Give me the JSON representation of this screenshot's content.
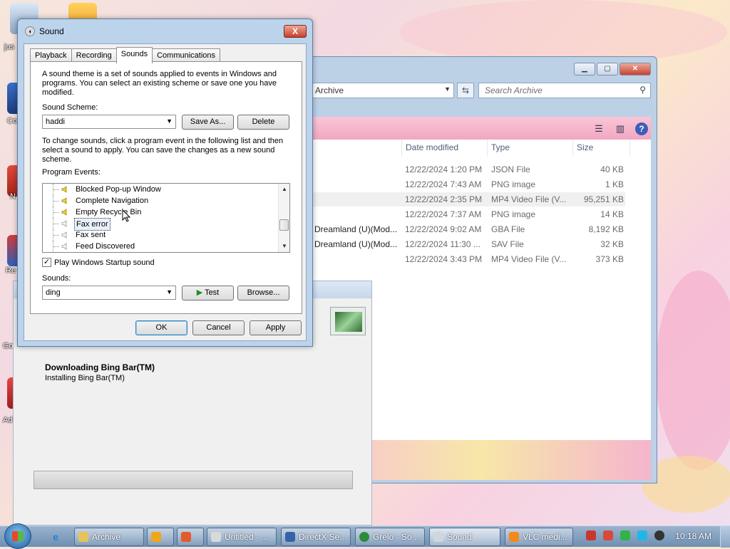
{
  "desktop": {
    "icon_labels": [
      "jus",
      "Co",
      "N",
      "Re",
      "Go",
      "Ad"
    ]
  },
  "explorer": {
    "address": "Archive",
    "search_placeholder": "Search Archive",
    "columns": [
      "Date modified",
      "Type",
      "Size"
    ],
    "rows": [
      {
        "name": "",
        "date": "12/22/2024 1:20 PM",
        "type": "JSON File",
        "size": "40 KB"
      },
      {
        "name": "",
        "date": "12/22/2024 7:43 AM",
        "type": "PNG image",
        "size": "1 KB"
      },
      {
        "name": "",
        "date": "12/22/2024 2:35 PM",
        "type": "MP4 Video File (V...",
        "size": "95,251 KB"
      },
      {
        "name": "",
        "date": "12/22/2024 7:37 AM",
        "type": "PNG image",
        "size": "14 KB"
      },
      {
        "name": "Dreamland (U)(Mod...",
        "date": "12/22/2024 9:02 AM",
        "type": "GBA File",
        "size": "8,192 KB"
      },
      {
        "name": "Dreamland (U)(Mod...",
        "date": "12/22/2024 11:30 ...",
        "type": "SAV File",
        "size": "32 KB"
      },
      {
        "name": "",
        "date": "12/22/2024 3:43 PM",
        "type": "MP4 Video File (V...",
        "size": "373 KB"
      }
    ]
  },
  "installer": {
    "heading": "Downloading Bing Bar(TM)",
    "subtext": "Installing Bing Bar(TM)"
  },
  "sound_dialog": {
    "title": "Sound",
    "close_label": "X",
    "tabs": [
      "Playback",
      "Recording",
      "Sounds",
      "Communications"
    ],
    "intro": "A sound theme is a set of sounds applied to events in Windows and programs.  You can select an existing scheme or save one you have modified.",
    "scheme_label": "Sound Scheme:",
    "scheme_value": "haddi",
    "save_as_label": "Save As...",
    "delete_label": "Delete",
    "instructions": "To change sounds, click a program event in the following list and then select a sound to apply.  You can save the changes as a new sound scheme.",
    "events_label": "Program Events:",
    "events": [
      {
        "label": "Blocked Pop-up Window",
        "has_sound": true
      },
      {
        "label": "Complete Navigation",
        "has_sound": true
      },
      {
        "label": "Empty Recycle Bin",
        "has_sound": true
      },
      {
        "label": "Fax error",
        "has_sound": false
      },
      {
        "label": "Fax sent",
        "has_sound": false
      },
      {
        "label": "Feed Discovered",
        "has_sound": false
      }
    ],
    "startup_checkbox_label": "Play Windows Startup sound",
    "startup_checked": true,
    "check_mark": "✓",
    "sounds_label": "Sounds:",
    "sound_value": "ding",
    "test_label": "Test",
    "browse_label": "Browse...",
    "ok_label": "OK",
    "cancel_label": "Cancel",
    "apply_label": "Apply"
  },
  "taskbar": {
    "items": [
      {
        "label": "Archive",
        "active": false
      },
      {
        "label": "",
        "active": false
      },
      {
        "label": "",
        "active": false
      },
      {
        "label": "Untitled - ...",
        "active": false
      },
      {
        "label": "DirectX Se...",
        "active": false
      },
      {
        "label": "Grelo - Só ...",
        "active": false
      },
      {
        "label": "Sound",
        "active": true
      },
      {
        "label": "VLC medi...",
        "active": false
      }
    ],
    "clock": "10:18 AM"
  },
  "colors": {
    "explorer_frame": "#bcd0e6",
    "pink_toolbar": "#f2a7c1",
    "dialog_frame": "#bcd3ec",
    "close_red": "#c6412b",
    "taskbar": "#6e8fb2"
  }
}
